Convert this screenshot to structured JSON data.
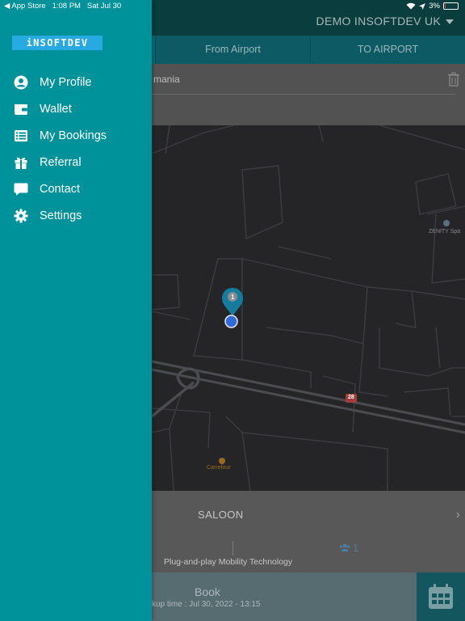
{
  "status_bar": {
    "back_app": "◀ App Store",
    "time": "1:08 PM",
    "date": "Sat Jul 30",
    "battery": "3%"
  },
  "header": {
    "company": "DEMO INSOFTDEV UK"
  },
  "tabs": [
    {
      "label": ""
    },
    {
      "label": "From Airport"
    },
    {
      "label": "TO AIRPORT"
    }
  ],
  "address": {
    "partial": "mania"
  },
  "map": {
    "poi_1": "ZENITY Spa",
    "poi_2": "Carrefour",
    "road_badge": "28",
    "pin_label": "1"
  },
  "vehicle": {
    "type": "SALOON",
    "passengers": "1",
    "tagline": "Plug-and-play Mobility Technology"
  },
  "book": {
    "label": "Book",
    "pickup": "ckup time : Jul 30, 2022 - 13:15"
  },
  "drawer": {
    "logo": "iNSOFTDEV",
    "items": [
      {
        "label": "My Profile",
        "icon": "profile-icon"
      },
      {
        "label": "Wallet",
        "icon": "wallet-icon"
      },
      {
        "label": "My Bookings",
        "icon": "list-icon"
      },
      {
        "label": "Referral",
        "icon": "gift-icon"
      },
      {
        "label": "Contact",
        "icon": "chat-icon"
      },
      {
        "label": "Settings",
        "icon": "gear-icon"
      }
    ]
  },
  "colors": {
    "drawer": "#00929a",
    "logo_bg": "#27a9e1",
    "header": "#0a3d3e"
  }
}
